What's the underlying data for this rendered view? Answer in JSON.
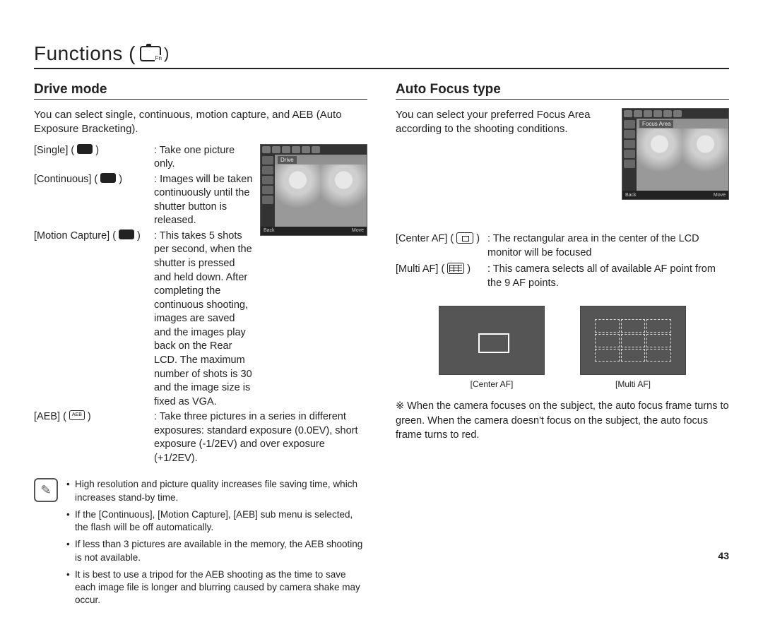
{
  "page_title_prefix": "Functions (",
  "page_title_suffix": ")",
  "page_number": "43",
  "left": {
    "section_title": "Drive mode",
    "intro": "You can select single, continuous, motion capture, and AEB (Auto Exposure Bracketing).",
    "thumb_label": "Drive",
    "thumb_back": "Back",
    "thumb_move": "Move",
    "modes": [
      {
        "label": "[Single]",
        "desc": "Take one picture only."
      },
      {
        "label": "[Continuous]",
        "desc": "Images will be taken continuously until the shutter button is released."
      },
      {
        "label": "[Motion Capture]",
        "desc": "This takes 5 shots per second, when the shutter is pressed and held down. After completing the continuous shooting, images are saved and the images play back on the Rear LCD. The maximum number of shots is 30 and the image size is fixed as VGA."
      },
      {
        "label": "[AEB]",
        "desc": "Take three pictures in a series in different exposures: standard exposure (0.0EV), short exposure (-1/2EV) and over exposure (+1/2EV)."
      }
    ],
    "notes": [
      "High resolution and picture quality increases file saving time, which increases stand-by time.",
      "If the [Continuous], [Motion Capture], [AEB] sub menu is selected, the flash will be off automatically.",
      "If less than 3 pictures are available in the memory, the AEB shooting is not available.",
      "It is best to use a tripod for the AEB shooting as the time to save each image file is longer and blurring caused by camera shake may occur."
    ]
  },
  "right": {
    "section_title": "Auto Focus type",
    "intro": "You can select your preferred Focus Area according to the shooting conditions.",
    "thumb_label": "Focus Area",
    "thumb_back": "Back",
    "thumb_move": "Move",
    "af_modes": [
      {
        "label": "[Center AF]",
        "desc": "The rectangular area in the center of the LCD monitor will be focused"
      },
      {
        "label": "[Multi AF]",
        "desc": "This camera selects all of available AF point from the 9 AF points."
      }
    ],
    "diagram_center": "[Center AF]",
    "diagram_multi": "[Multi AF]",
    "footer_note": "※ When the camera focuses on the subject, the auto focus frame turns to green. When the camera doesn't focus on the subject, the auto focus frame turns to red."
  }
}
